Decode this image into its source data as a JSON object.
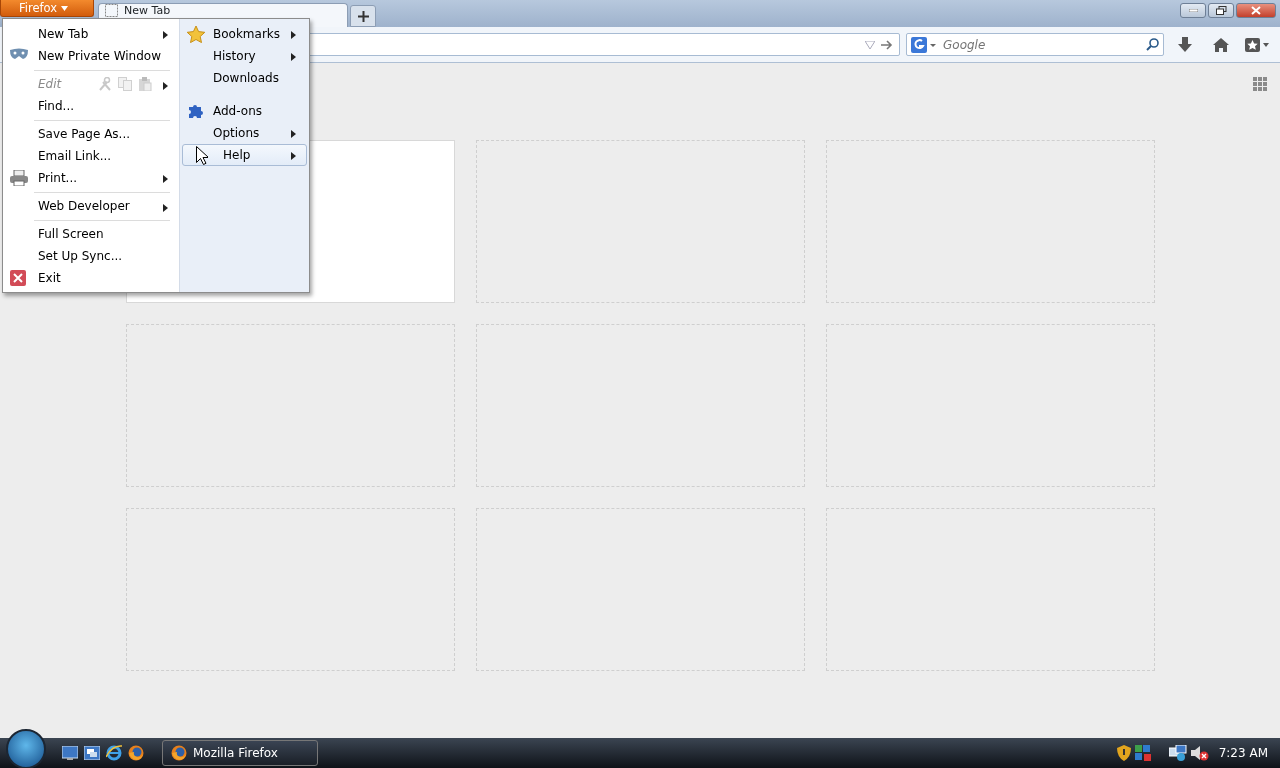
{
  "firefox_button": {
    "label": "Firefox"
  },
  "tabs": [
    {
      "label": "New Tab",
      "selected": true
    }
  ],
  "search": {
    "placeholder": "Google"
  },
  "app_menu": {
    "left_items": [
      {
        "label": "New Tab",
        "submenu": true,
        "disabled": false,
        "separator_before": false
      },
      {
        "label": "New Private Window",
        "submenu": false,
        "disabled": false,
        "separator_before": false
      },
      {
        "label": "Edit",
        "submenu": true,
        "disabled": true,
        "separator_before": true
      },
      {
        "label": "Find...",
        "submenu": false,
        "disabled": false,
        "separator_before": false
      },
      {
        "label": "Save Page As...",
        "submenu": false,
        "disabled": false,
        "separator_before": true
      },
      {
        "label": "Email Link...",
        "submenu": false,
        "disabled": false,
        "separator_before": false
      },
      {
        "label": "Print...",
        "submenu": true,
        "disabled": false,
        "separator_before": false
      },
      {
        "label": "Web Developer",
        "submenu": true,
        "disabled": false,
        "separator_before": true
      },
      {
        "label": "Full Screen",
        "submenu": false,
        "disabled": false,
        "separator_before": true
      },
      {
        "label": "Set Up Sync...",
        "submenu": false,
        "disabled": false,
        "separator_before": false
      },
      {
        "label": "Exit",
        "submenu": false,
        "disabled": false,
        "separator_before": false
      }
    ],
    "right_items": [
      {
        "label": "Bookmarks",
        "submenu": true,
        "selected": false,
        "separator_before": false
      },
      {
        "label": "History",
        "submenu": true,
        "selected": false,
        "separator_before": false
      },
      {
        "label": "Downloads",
        "submenu": false,
        "selected": false,
        "separator_before": false
      },
      {
        "label": "Add-ons",
        "submenu": false,
        "selected": false,
        "separator_before": true
      },
      {
        "label": "Options",
        "submenu": true,
        "selected": false,
        "separator_before": false
      },
      {
        "label": "Help",
        "submenu": true,
        "selected": true,
        "separator_before": false
      }
    ]
  },
  "thumbnails": [
    {
      "filled": true
    },
    {
      "filled": false
    },
    {
      "filled": false
    },
    {
      "filled": false
    },
    {
      "filled": false
    },
    {
      "filled": false
    },
    {
      "filled": false
    },
    {
      "filled": false
    },
    {
      "filled": false
    }
  ],
  "taskbar": {
    "window_button": "Mozilla Firefox",
    "clock": "7:23 AM"
  }
}
